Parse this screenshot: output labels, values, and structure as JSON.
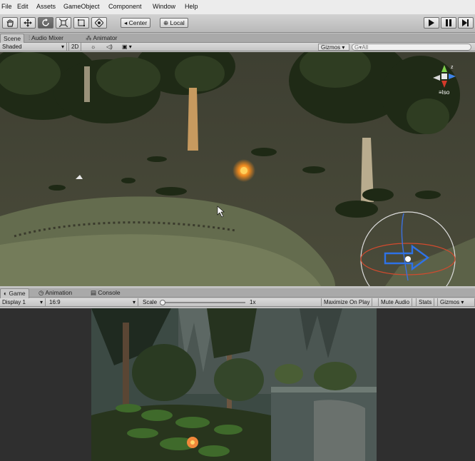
{
  "menu": [
    "File",
    "Edit",
    "Assets",
    "GameObject",
    "Component",
    "Window",
    "Help"
  ],
  "toolbar": {
    "tools": [
      "hand-tool",
      "move-tool",
      "rotate-tool",
      "scale-tool",
      "rect-tool",
      "transform-tool"
    ],
    "active_tool_index": 2,
    "pivot_label": "Center",
    "space_label": "Local"
  },
  "scene_tabs": [
    "Scene",
    "Audio Mixer",
    "Animator"
  ],
  "scene_controls": {
    "shading": "Shaded",
    "mode_2d": "2D",
    "gizmos": "Gizmos",
    "search_placeholder": "G▾All"
  },
  "gizmo": {
    "z_label": "z",
    "persp_label": "Iso"
  },
  "game_tabs": [
    "Game",
    "Animation",
    "Console"
  ],
  "game_controls": {
    "display": "Display 1",
    "aspect": "16:9",
    "scale_label": "Scale",
    "scale_value": "1x",
    "maximize": "Maximize On Play",
    "mute": "Mute Audio",
    "stats": "Stats",
    "gizmos": "Gizmos"
  },
  "colors": {
    "accent_active": "#5f5f5f",
    "panel": "#c2c2c2",
    "game_bg": "#2f2f2f"
  }
}
